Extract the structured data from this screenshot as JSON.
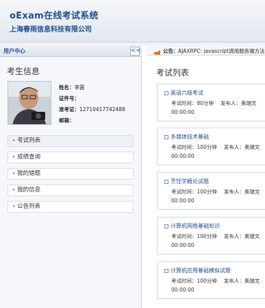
{
  "header": {
    "title": "oExam在线考试系统",
    "subtitle": "上海春雨信息科技有限公司"
  },
  "sidebar": {
    "header_label": "用户中心",
    "collapse_label": "<<",
    "section_title": "考生信息",
    "profile": {
      "name_label": "姓名：",
      "name_value": "李霞",
      "id_label": "证件号：",
      "id_value": "",
      "admission_label": "准考证：",
      "admission_value": "12710417742488",
      "email_label": "邮箱：",
      "email_value": ""
    },
    "menu": [
      {
        "label": "考试列表"
      },
      {
        "label": "成绩查询"
      },
      {
        "label": "我的错题"
      },
      {
        "label": "我的信息"
      },
      {
        "label": "公告列表"
      }
    ]
  },
  "notice": {
    "label": "公告：",
    "text": "AJAXRPC: javascript调用服务端方法"
  },
  "main": {
    "title": "考试列表",
    "exams": [
      {
        "name": "英语六级考试",
        "time_label": "考试时间：80分钟",
        "publisher": "发布人：奥瑞文",
        "start": "00:00:00"
      },
      {
        "name": "多媒体技术基础",
        "time_label": "考试时间：100分钟",
        "publisher": "发布人：奥瑞文",
        "start": "00:00:00"
      },
      {
        "name": "烹饪学概论试题",
        "time_label": "考试时间：100分钟",
        "publisher": "发布人：奥瑞文",
        "start": "00:00:00"
      },
      {
        "name": "计算机网络基础知识",
        "time_label": "考试时间：100分钟",
        "publisher": "发布人：奥瑞文",
        "start": "00:00:00"
      },
      {
        "name": "计算机应用基础模拟试题",
        "time_label": "考试时间：100分钟",
        "publisher": "发布人：奥瑞文",
        "start": "00:00:00"
      }
    ]
  },
  "colors": {
    "brand": "#1d4f8c",
    "border": "#c9d2de"
  }
}
